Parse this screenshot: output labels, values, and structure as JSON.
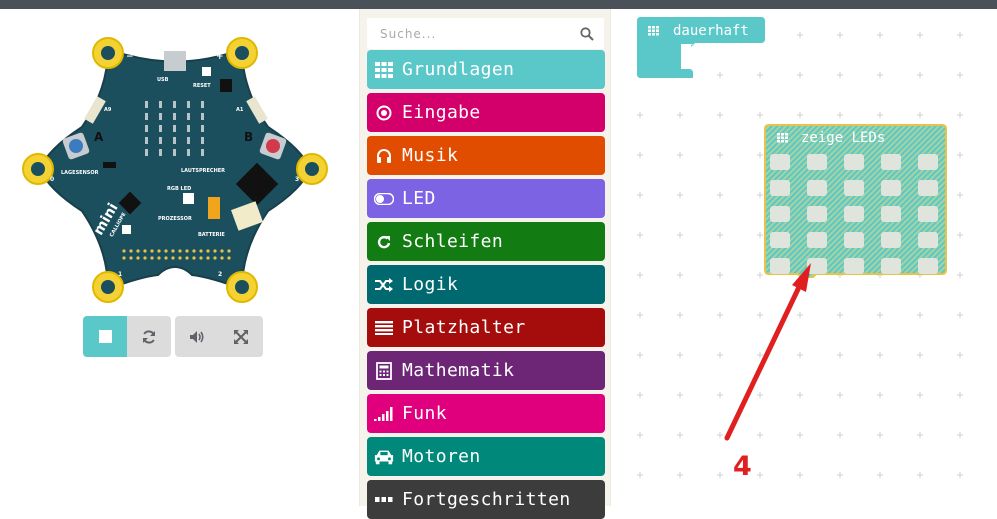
{
  "colors": {
    "grundlagen": "#5ac8c9",
    "eingabe": "#d3006b",
    "musik": "#e04c00",
    "led": "#7b63e4",
    "schleifen": "#127b12",
    "logik": "#006970",
    "platzhalter": "#a50c0c",
    "mathematik": "#6d2576",
    "funk": "#e0007e",
    "motoren": "#00897a",
    "fortgeschritten": "#3c3c3c",
    "annotation": "#e02020"
  },
  "simulator": {
    "board_labels": {
      "minus": "−",
      "plus": "+",
      "usb": "USB",
      "reset": "RESET",
      "a9": "A9",
      "a1": "A1",
      "button_a": "A",
      "button_b": "B",
      "lagesensor": "LAGESENSOR",
      "lautsprecher": "LAUTSPRECHER",
      "rgb_led": "RGB LED",
      "prozessor": "PROZESSOR",
      "batterie": "BATTERIE",
      "pin0": "0",
      "pin1": "1",
      "pin2": "2",
      "pin3": "3",
      "logo_text": "mini",
      "logo_sub": "CALLIOPE"
    },
    "controls": {
      "stop_icon": "stop-square-icon",
      "restart_icon": "restart-icon",
      "sound_icon": "speaker-icon",
      "fullscreen_icon": "fullscreen-icon"
    }
  },
  "toolbox": {
    "search_placeholder": "Suche...",
    "categories": [
      {
        "label": "Grundlagen",
        "icon": "grid-icon"
      },
      {
        "label": "Eingabe",
        "icon": "target-icon"
      },
      {
        "label": "Musik",
        "icon": "headphones-icon"
      },
      {
        "label": "LED",
        "icon": "toggle-icon"
      },
      {
        "label": "Schleifen",
        "icon": "loop-icon"
      },
      {
        "label": "Logik",
        "icon": "shuffle-icon"
      },
      {
        "label": "Platzhalter",
        "icon": "list-icon"
      },
      {
        "label": "Mathematik",
        "icon": "calculator-icon"
      },
      {
        "label": "Funk",
        "icon": "signal-bars-icon"
      },
      {
        "label": "Motoren",
        "icon": "car-icon"
      },
      {
        "label": "Fortgeschritten",
        "icon": "more-dots-icon"
      }
    ]
  },
  "workspace": {
    "forever_block": "dauerhaft",
    "show_leds_block": "zeige LEDs",
    "annotation_number": "4"
  }
}
